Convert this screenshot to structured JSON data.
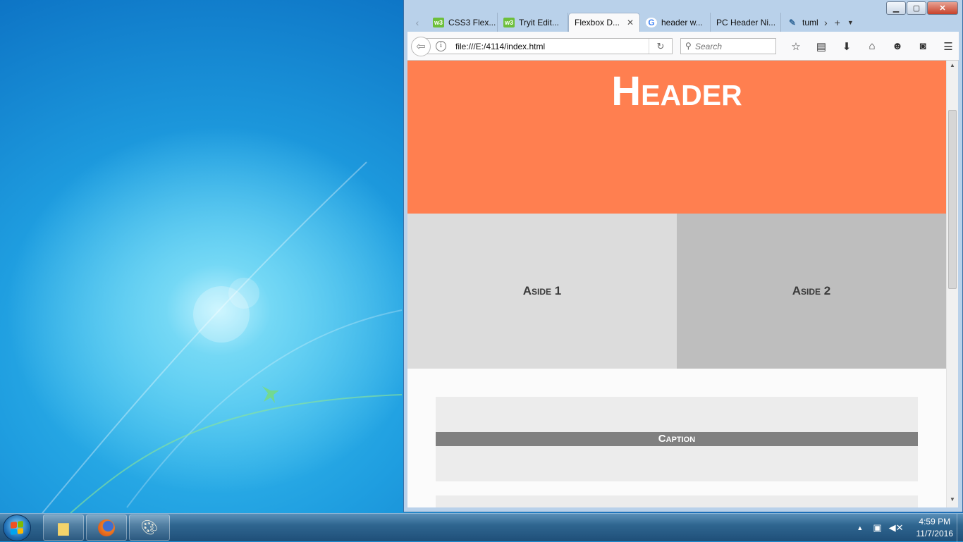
{
  "browser": {
    "tabs": [
      {
        "label": "CSS3 Flex...",
        "icon": "w3schools-icon"
      },
      {
        "label": "Tryit Edit...",
        "icon": "w3schools-icon"
      },
      {
        "label": "Flexbox D...",
        "icon": "",
        "active": true
      },
      {
        "label": "header w...",
        "icon": "google-icon"
      },
      {
        "label": "PC Header Ni...",
        "icon": ""
      },
      {
        "label": "tuml",
        "icon": "tumblr-icon"
      }
    ],
    "w3_badge": "w3",
    "google_badge": "G",
    "url": "file:///E:/4114/index.html",
    "search_placeholder": "Search"
  },
  "page": {
    "header": "Header",
    "aside1": "Aside 1",
    "aside2": "Aside 2",
    "caption": "Caption"
  },
  "taskbar": {
    "time": "4:59 PM",
    "date": "11/7/2016"
  },
  "colors": {
    "header_bg": "#ff7f50",
    "aside1_bg": "#dcdcdc",
    "aside2_bg": "#bebebe",
    "caption_bg": "#808080"
  }
}
